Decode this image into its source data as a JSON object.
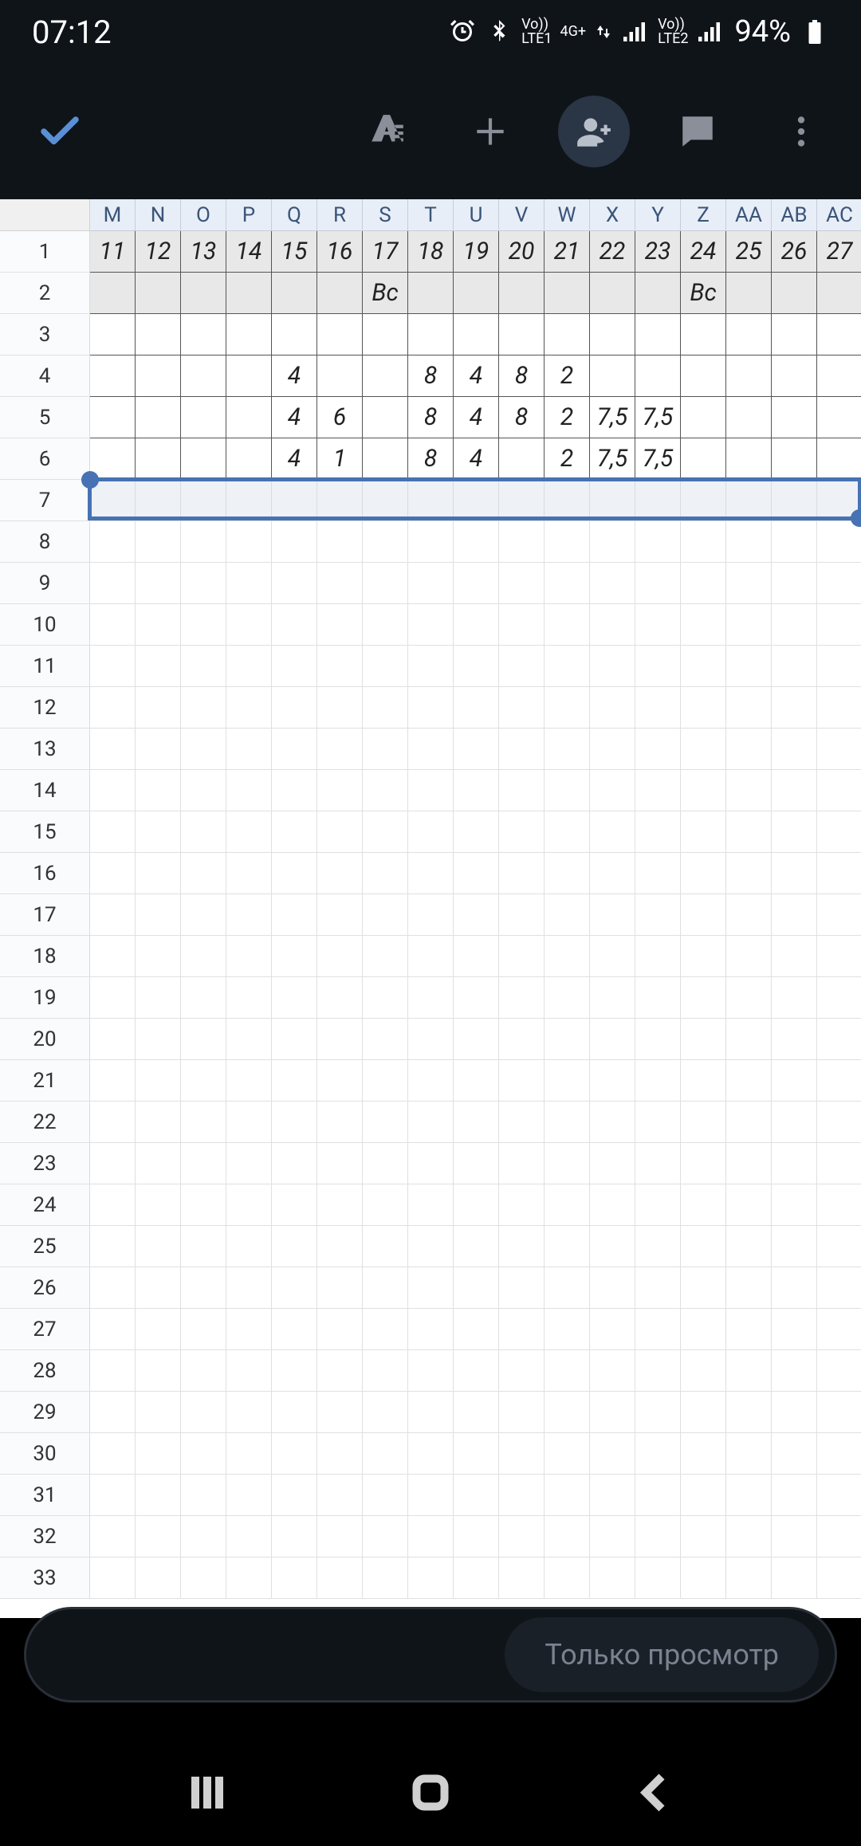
{
  "status": {
    "time": "07:12",
    "battery": "94%",
    "lte1": "LTE1",
    "lte2": "LTE2",
    "net": "4G+",
    "vo": "Vo))"
  },
  "columns": [
    "M",
    "N",
    "O",
    "P",
    "Q",
    "R",
    "S",
    "T",
    "U",
    "V",
    "W",
    "X",
    "Y",
    "Z",
    "AA",
    "AB",
    "AC"
  ],
  "row_numbers": [
    "1",
    "2",
    "3",
    "4",
    "5",
    "6",
    "7",
    "8",
    "9",
    "10",
    "11",
    "12",
    "13",
    "14",
    "15",
    "16",
    "17",
    "18",
    "19",
    "20",
    "21",
    "22",
    "23",
    "24",
    "25",
    "26",
    "27",
    "28",
    "29",
    "30",
    "31",
    "32",
    "33"
  ],
  "data": {
    "r1": [
      "11",
      "12",
      "13",
      "14",
      "15",
      "16",
      "17",
      "18",
      "19",
      "20",
      "21",
      "22",
      "23",
      "24",
      "25",
      "26",
      "27"
    ],
    "r2": [
      "",
      "",
      "",
      "",
      "",
      "",
      "Вс",
      "",
      "",
      "",
      "",
      "",
      "",
      "Вс",
      "",
      "",
      ""
    ],
    "r3": [
      "",
      "",
      "",
      "",
      "",
      "",
      "",
      "",
      "",
      "",
      "",
      "",
      "",
      "",
      "",
      "",
      ""
    ],
    "r4": [
      "",
      "",
      "",
      "",
      "4",
      "",
      "",
      "8",
      "4",
      "8",
      "2",
      "",
      "",
      "",
      "",
      "",
      ""
    ],
    "r5": [
      "",
      "",
      "",
      "",
      "4",
      "6",
      "",
      "8",
      "4",
      "8",
      "2",
      "7,5",
      "7,5",
      "",
      "",
      "",
      ""
    ],
    "r6": [
      "",
      "",
      "",
      "",
      "4",
      "1",
      "",
      "8",
      "4",
      "",
      "2",
      "7,5",
      "7,5",
      "",
      "",
      "",
      ""
    ]
  },
  "selected_row": 7,
  "bottom": {
    "view_only": "Только просмотр"
  }
}
